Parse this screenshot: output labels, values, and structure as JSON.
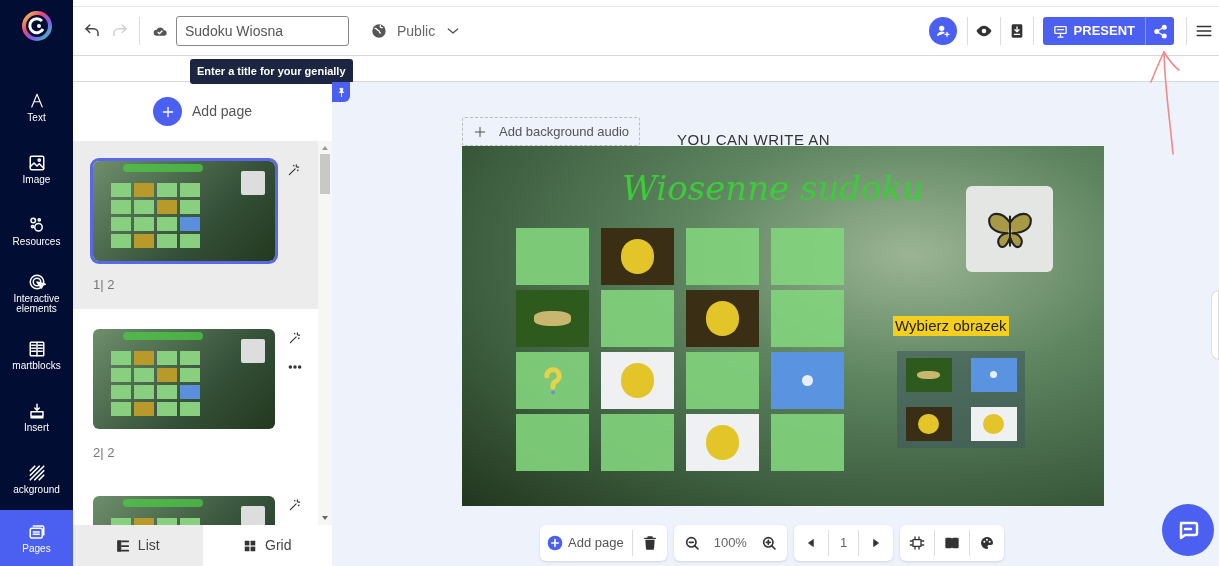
{
  "sidebar": {
    "items": [
      {
        "label": "Text",
        "kind": "text",
        "selected": false
      },
      {
        "label": "Image",
        "kind": "image",
        "selected": false
      },
      {
        "label": "Resources",
        "kind": "resources",
        "selected": false
      },
      {
        "label": "Interactive elements",
        "kind": "interactive",
        "selected": false
      },
      {
        "label": "martblocks",
        "kind": "smartblocks",
        "selected": false
      },
      {
        "label": "Insert",
        "kind": "insert",
        "selected": false
      },
      {
        "label": "ackground",
        "kind": "background",
        "selected": false
      },
      {
        "label": "Pages",
        "kind": "pages",
        "selected": true
      }
    ]
  },
  "topbar": {
    "title_field": {
      "value": "Sudoku Wiosna"
    },
    "tooltip": "Enter a title for your genially",
    "visibility": "Public",
    "present_button": "PRESENT"
  },
  "pages_panel": {
    "add_page": "Add page",
    "pages": [
      {
        "number": "1| 2",
        "selected": true
      },
      {
        "number": "2| 2",
        "selected": false
      },
      {
        "selected": false
      }
    ],
    "view_tabs": [
      {
        "label": "List",
        "selected": true
      },
      {
        "label": "Grid",
        "selected": false
      }
    ]
  },
  "canvas": {
    "add_audio": "Add background audio",
    "caption": "YOU CAN WRITE AN",
    "slide": {
      "title": "Wiosenne sudoku",
      "grid": [
        [
          {
            "kind": "empty"
          },
          {
            "kind": "chick"
          },
          {
            "kind": "empty"
          },
          {
            "kind": "empty"
          }
        ],
        [
          {
            "kind": "butterfly"
          },
          {
            "kind": "empty"
          },
          {
            "kind": "chick"
          },
          {
            "kind": "empty"
          }
        ],
        [
          {
            "kind": "question"
          },
          {
            "kind": "chick_white"
          },
          {
            "kind": "empty"
          },
          {
            "kind": "flower"
          }
        ],
        [
          {
            "kind": "empty"
          },
          {
            "kind": "empty"
          },
          {
            "kind": "chick_white"
          },
          {
            "kind": "empty"
          }
        ]
      ],
      "label": "Wybierz obrazek",
      "choices": [
        {
          "kind": "butterfly"
        },
        {
          "kind": "flower"
        },
        {
          "kind": "chick"
        },
        {
          "kind": "chick_white"
        }
      ]
    }
  },
  "bottom_toolbar": {
    "add_page": "Add page",
    "zoom": "100%",
    "page": "1"
  }
}
